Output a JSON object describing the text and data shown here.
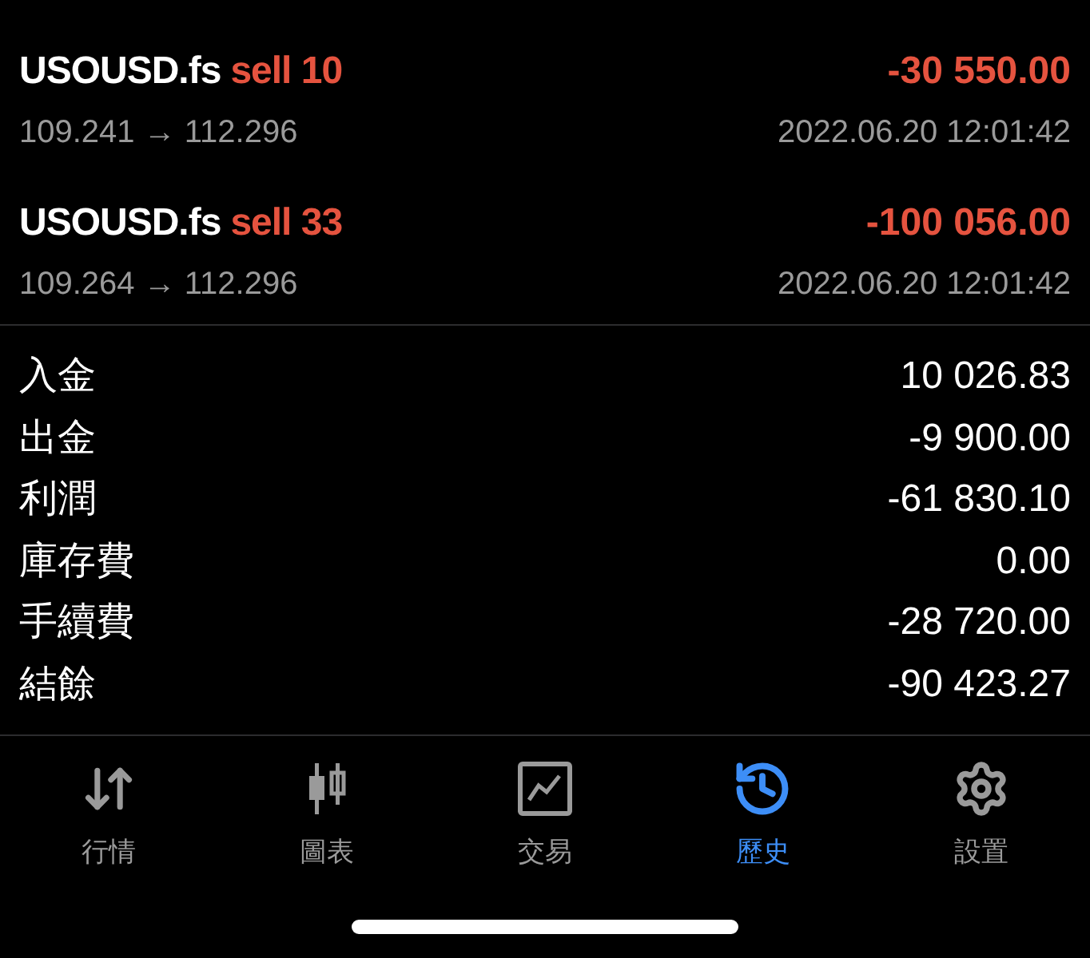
{
  "trades": [
    {
      "symbol": "USOUSD.fs",
      "kind": "sell",
      "side": "sell 10",
      "profit": "-30 550.00",
      "prices": "109.241 → 112.296",
      "time": "2022.06.20 12:01:42"
    },
    {
      "symbol": "USOUSD.fs",
      "kind": "sell",
      "side": "sell 33",
      "profit": "-100 056.00",
      "prices": "109.264 → 112.296",
      "time": "2022.06.20 12:01:42"
    }
  ],
  "summary": [
    {
      "label": "入金",
      "value": "10 026.83"
    },
    {
      "label": "出金",
      "value": "-9 900.00"
    },
    {
      "label": "利潤",
      "value": "-61 830.10"
    },
    {
      "label": "庫存費",
      "value": "0.00"
    },
    {
      "label": "手續費",
      "value": "-28 720.00"
    },
    {
      "label": "結餘",
      "value": "-90 423.27"
    }
  ],
  "tabs": [
    {
      "kind": "quotes",
      "label": "行情",
      "selected": false
    },
    {
      "kind": "chart",
      "label": "圖表",
      "selected": false
    },
    {
      "kind": "trade",
      "label": "交易",
      "selected": false
    },
    {
      "kind": "history",
      "label": "歷史",
      "selected": true
    },
    {
      "kind": "settings",
      "label": "設置",
      "selected": false
    }
  ]
}
